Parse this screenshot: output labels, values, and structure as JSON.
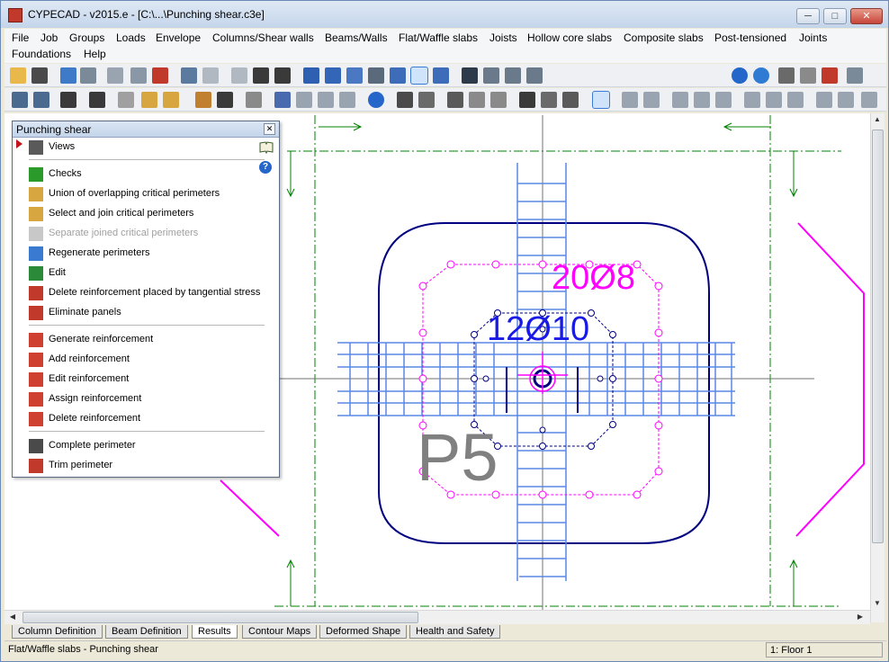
{
  "window": {
    "title": "CYPECAD - v2015.e - [C:\\...\\Punching shear.c3e]",
    "minimize_label": "─",
    "maximize_label": "□",
    "close_label": "✕"
  },
  "menu": [
    "File",
    "Job",
    "Groups",
    "Loads",
    "Envelope",
    "Columns/Shear walls",
    "Beams/Walls",
    "Flat/Waffle slabs",
    "Joists",
    "Hollow core slabs",
    "Composite slabs",
    "Post-tensioned",
    "Joints",
    "Foundations",
    "Help"
  ],
  "toolbar1_icons": [
    "open-folder",
    "save",
    "tool-a",
    "tool-b",
    "grid",
    "calc",
    "magnet",
    "undo",
    "redo",
    "move-up",
    "move-updown",
    "move-down",
    "zoom-window",
    "zoom-in",
    "zoom-out",
    "pencil",
    "zoom-all",
    "pan-hand",
    "redraw",
    "view-3d",
    "axes-a",
    "axes-b",
    "axes-c",
    "help",
    "globe",
    "print",
    "pdf",
    "export",
    "exit"
  ],
  "toolbar2_icons": [
    "t01",
    "t02",
    "t03",
    "t04",
    "t05",
    "t06",
    "t07",
    "t08",
    "t09",
    "t10",
    "t11",
    "t12",
    "t13",
    "t14",
    "t15",
    "t16",
    "t17",
    "info",
    "t19",
    "t20",
    "t21",
    "t22",
    "t23",
    "t24",
    "t25",
    "t26",
    "t27",
    "t28",
    "t29",
    "t30",
    "t31",
    "t32",
    "t33",
    "t34",
    "t35",
    "t36",
    "t37",
    "t38"
  ],
  "colors": {
    "accent": "#1e3a8a",
    "magenta": "#ff00ff",
    "green": "#008000",
    "blue_bar": "#5a87e6",
    "dark_blue": "#000080",
    "label_blue": "#1a1ae6",
    "column_gray": "#808080"
  },
  "panel": {
    "title": "Punching shear",
    "close_label": "✕",
    "help_label": "?",
    "items": [
      {
        "label": "Views",
        "disabled": false
      },
      {
        "label": "Checks",
        "disabled": false
      },
      {
        "label": "Union of overlapping critical perimeters",
        "disabled": false
      },
      {
        "label": "Select and join critical perimeters",
        "disabled": false
      },
      {
        "label": "Separate joined critical perimeters",
        "disabled": true
      },
      {
        "label": "Regenerate perimeters",
        "disabled": false
      },
      {
        "label": "Edit",
        "disabled": false
      },
      {
        "label": "Delete reinforcement placed by tangential stress",
        "disabled": false
      },
      {
        "label": "Eliminate panels",
        "disabled": false
      },
      {
        "label": "Generate reinforcement",
        "disabled": false
      },
      {
        "label": "Add reinforcement",
        "disabled": false
      },
      {
        "label": "Edit reinforcement",
        "disabled": false
      },
      {
        "label": "Assign reinforcement",
        "disabled": false
      },
      {
        "label": "Delete reinforcement",
        "disabled": false
      },
      {
        "label": "Complete perimeter",
        "disabled": false
      },
      {
        "label": "Trim perimeter",
        "disabled": false
      }
    ]
  },
  "drawing": {
    "label_outer_reinf": "20Ø8",
    "label_inner_reinf": "12Ø10",
    "column_label": "P5"
  },
  "tabs": [
    {
      "label": "Column Definition",
      "active": false
    },
    {
      "label": "Beam Definition",
      "active": false
    },
    {
      "label": "Results",
      "active": true
    },
    {
      "label": "Contour Maps",
      "active": false
    },
    {
      "label": "Deformed Shape",
      "active": false
    },
    {
      "label": "Health and Safety",
      "active": false
    }
  ],
  "status": {
    "left": "Flat/Waffle slabs - Punching shear",
    "floor": "1: Floor 1"
  }
}
